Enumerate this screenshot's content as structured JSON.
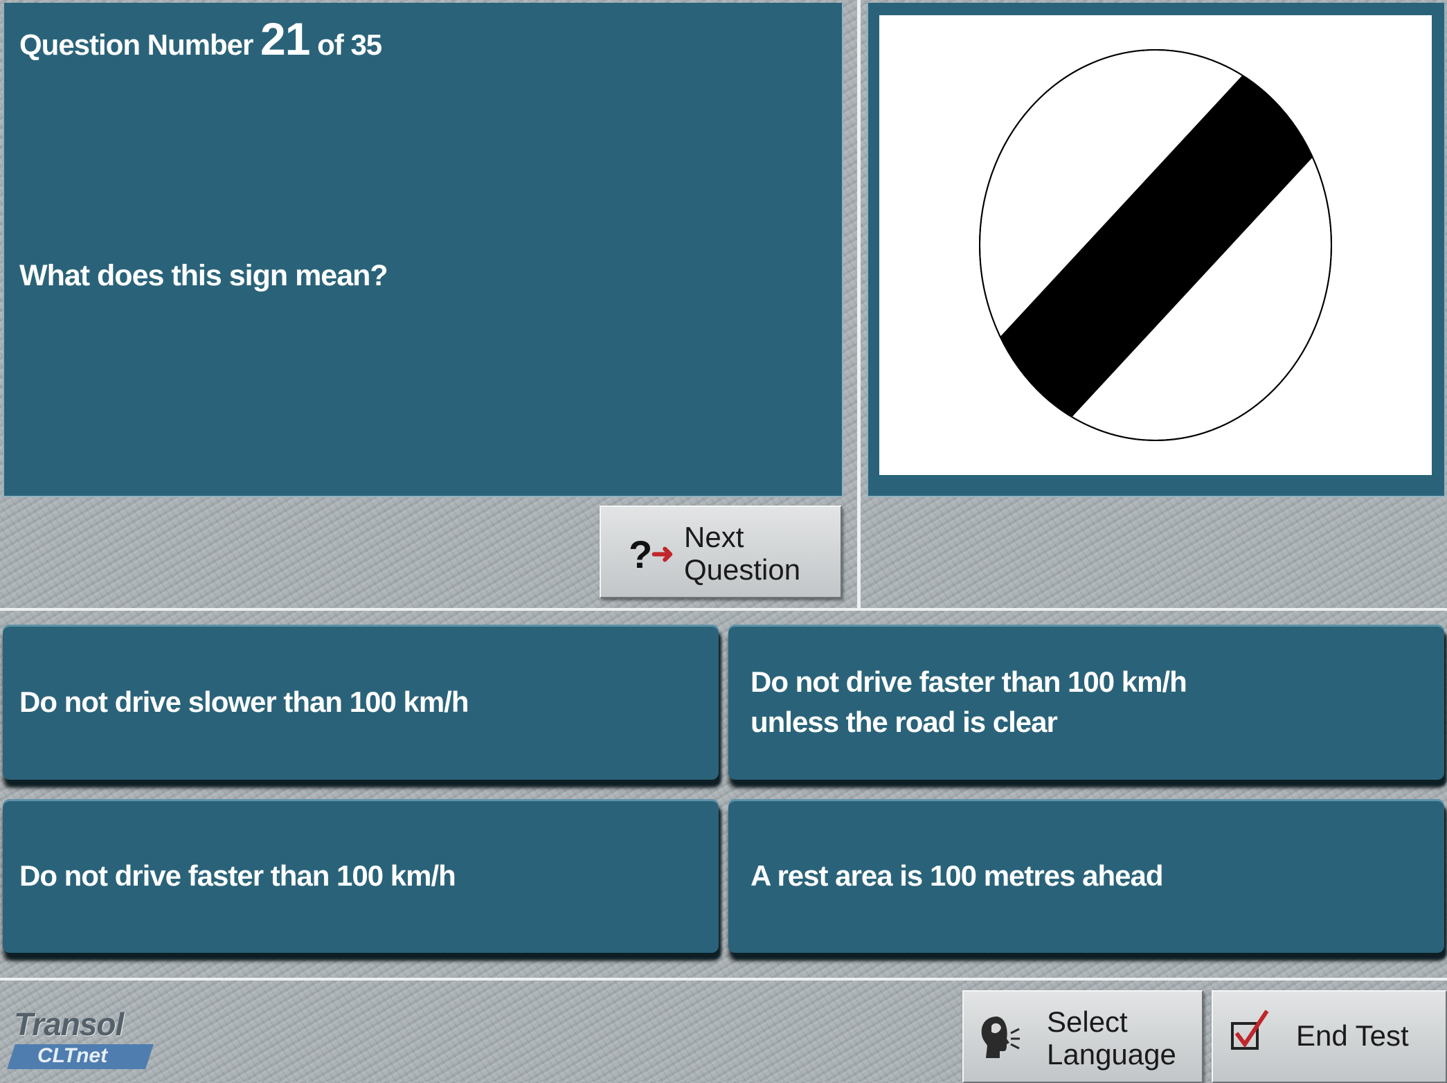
{
  "question": {
    "number_prefix": "Question Number",
    "number": "21",
    "of_total": "of 35",
    "text": "What does this sign mean?"
  },
  "sign": {
    "icon": "end-of-speed-limit-sign-icon",
    "colors": {
      "fill": "#ffffff",
      "band": "#000000",
      "outline": "#000000"
    }
  },
  "nav": {
    "next_label": "Next\nQuestion",
    "next_icon": "question-arrow-icon"
  },
  "answers": [
    {
      "text": "Do not drive slower than 100 km/h"
    },
    {
      "text": "Do not drive faster than 100 km/h\nunless the road is clear"
    },
    {
      "text": "Do not drive faster than 100 km/h"
    },
    {
      "text": "A rest area is 100 metres ahead"
    }
  ],
  "footer": {
    "logo_top": "Transol",
    "logo_sub": "CLTnet",
    "select_language_label": "Select\nLanguage",
    "select_language_icon": "speaking-head-icon",
    "end_test_label": "End Test",
    "end_test_icon": "checkbox-tick-icon"
  },
  "colors": {
    "panel": "#2a6379",
    "background": "#a5adb1",
    "button": "#d4d7d9",
    "accent_red": "#c0262b"
  }
}
